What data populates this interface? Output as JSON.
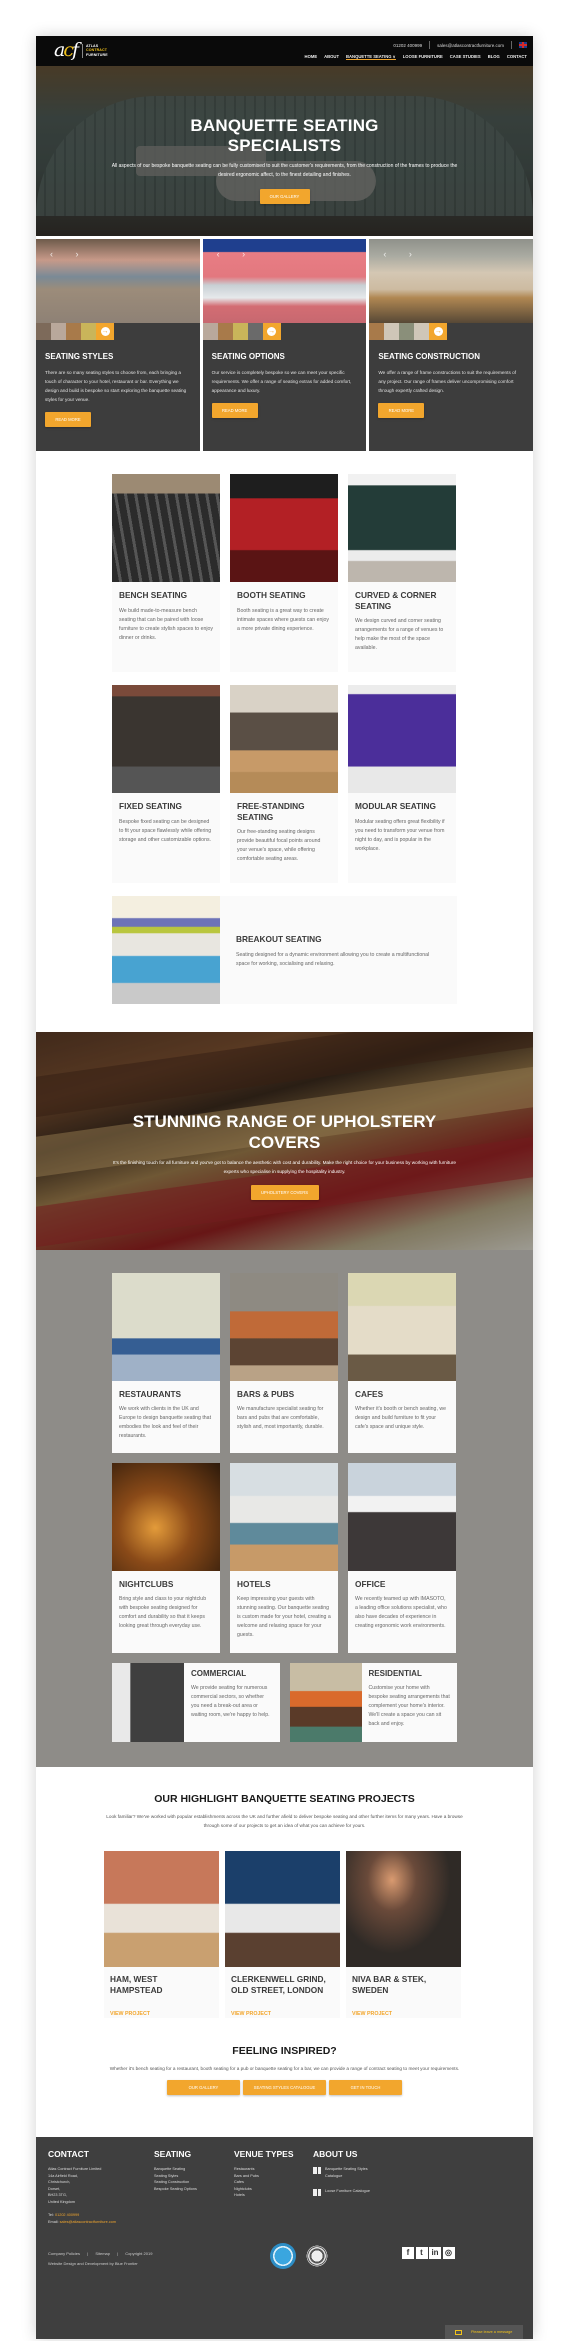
{
  "header": {
    "logo": {
      "mark_a": "a",
      "mark_c": "c",
      "mark_f": "f",
      "line1": "ATLAS",
      "line2": "CONTRACT",
      "line3": "FURNITURE"
    },
    "phone": "01202 400999",
    "email": "sales@atlascontractfurniture.com",
    "flag": "uk-flag-icon",
    "nav": [
      "HOME",
      "ABOUT",
      "BANQUETTE SEATING ∨",
      "LOOSE FURNITURE",
      "CASE STUDIES",
      "BLOG",
      "CONTACT"
    ],
    "active_nav": "BANQUETTE SEATING"
  },
  "hero": {
    "title_line1": "BANQUETTE SEATING",
    "title_line2": "SPECIALISTS",
    "description": "All aspects of our bespoke banquette seating can be fully customised to suit the customer's requirements, from the construction of the frames to produce the desired ergonomic affect, to the finest detailing and finishes.",
    "button": "OUR GALLERY"
  },
  "feature_cards": [
    {
      "title": "SEATING STYLES",
      "text": "There are so many seating styles to choose from, each bringing a touch of character to your hotel, restaurant or bar. Everything we design and build is bespoke so start exploring the banquette seating styles for your venue.",
      "button": "READ MORE"
    },
    {
      "title": "SEATING OPTIONS",
      "text": "Our service is completely bespoke so we can meet your specific requirements. We offer a range of seating extras for added comfort, appearance and luxury.",
      "button": "READ MORE"
    },
    {
      "title": "SEATING CONSTRUCTION",
      "text": "We offer a range of frame constructions to suit the requirements of any project. Our range of frames deliver uncompromising comfort through expertly crafted design.",
      "button": "READ MORE"
    }
  ],
  "slider_arrows": "‹ ›",
  "next_arrow": "→",
  "seating_types": [
    {
      "title": "BENCH SEATING",
      "text": "We build made-to-measure bench seating that can be paired with loose furniture to create stylish spaces to enjoy dinner or drinks."
    },
    {
      "title": "BOOTH SEATING",
      "text": "Booth seating is a great way to create intimate spaces where guests can enjoy a more private dining experience."
    },
    {
      "title": "CURVED & CORNER SEATING",
      "text": "We design curved and corner seating arrangements for a range of venues to help make the most of the space available."
    },
    {
      "title": "FIXED SEATING",
      "text": "Bespoke fixed seating can be designed to fit your space flawlessly while offering storage and other customizable options."
    },
    {
      "title": "FREE-STANDING SEATING",
      "text": "Our free-standing seating designs provide beautiful focal points around your venue's space, while offering comfortable seating areas."
    },
    {
      "title": "MODULAR SEATING",
      "text": "Modular seating offers great flexibility if you need to transform your venue from night to day, and is popular in the workplace."
    }
  ],
  "breakout": {
    "title": "BREAKOUT SEATING",
    "text": "Seating designed for a dynamic environment allowing you to create a multifunctional space for working, socialising and relaxing."
  },
  "upholstery": {
    "title_line1": "STUNNING RANGE OF UPHOLSTERY",
    "title_line2": "COVERS",
    "description": "It's the finishing touch for all furniture and you've got to balance the aesthetic with cost and durability. Make the right choice for your business by working with furniture experts who specialise in supplying the hospitality industry.",
    "button": "UPHOLSTERY COVERS"
  },
  "venues": [
    {
      "title": "RESTAURANTS",
      "text": "We work with clients in the UK and Europe to design banquette seating that embodies the look and feel of their restaurants."
    },
    {
      "title": "BARS & PUBS",
      "text": "We manufacture specialist seating for bars and pubs that are comfortable, stylish and, most importantly, durable."
    },
    {
      "title": "CAFES",
      "text": "Whether it's booth or bench seating, we design and build furniture to fit your cafe's space and unique style."
    },
    {
      "title": "NIGHTCLUBS",
      "text": "Bring style and class to your nightclub with bespoke seating designed for comfort and durability so that it keeps looking great through everyday use."
    },
    {
      "title": "HOTELS",
      "text": "Keep impressing your guests with stunning seating. Our banquette seating is custom made for your hotel, creating a welcome and relaxing space for your guests."
    },
    {
      "title": "OFFICE",
      "text": "We recently teamed up with IMASOTO, a leading office solutions specialist, who also have decades of experience in creating ergonomic work environments."
    },
    {
      "title": "COMMERCIAL",
      "text": "We provide seating for numerous commercial sectors, so whether you need a break-out area or waiting room, we're happy to help."
    },
    {
      "title": "RESIDENTIAL",
      "text": "Customise your home with bespoke seating arrangements that complement your home's interior. We'll create a space you can sit back and enjoy."
    }
  ],
  "projects": {
    "title": "OUR HIGHLIGHT BANQUETTE SEATING PROJECTS",
    "intro": "Look familiar? We've worked with popular establishments across the UK and further afield to deliver bespoke seating and other further items for many years. Have a browse through some of our projects to get an idea of what you can achieve for yours.",
    "items": [
      {
        "title_line1": "HAM, WEST",
        "title_line2": "HAMPSTEAD",
        "link": "VIEW PROJECT"
      },
      {
        "title_line1": "CLERKENWELL GRIND,",
        "title_line2": "OLD STREET, LONDON",
        "link": "VIEW PROJECT"
      },
      {
        "title_line1": "NIVA BAR & STEK,",
        "title_line2": "SWEDEN",
        "link": "VIEW PROJECT"
      }
    ]
  },
  "inspired": {
    "title": "FEELING INSPIRED?",
    "text": "Whether it's bench seating for a restaurant, booth seating for a pub or banquette seating for a bar, we can provide a range of contract seating to meet your requirements.",
    "buttons": [
      "OUR GALLERY",
      "SEATING STYLES CATALOGUE",
      "GET IN TOUCH"
    ]
  },
  "footer": {
    "contact": {
      "title": "CONTACT",
      "address": [
        "Atlas Contract Furniture Limited",
        "14a Airfield Road,",
        "Christchurch,",
        "Dorset,",
        "BH23 3TG,",
        "United Kingdom"
      ],
      "tel_label": "Tel:",
      "tel": "01202 400999",
      "email_label": "Email:",
      "email": "sales@atlascontractfurniture.com"
    },
    "seating": {
      "title": "SEATING",
      "links": [
        "Banquette Seating",
        "Seating Styles",
        "Seating Construction",
        "Bespoke Seating Options"
      ]
    },
    "venue_types": {
      "title": "VENUE TYPES",
      "links": [
        "Restaurants",
        "Bars and Pubs",
        "Cafes",
        "Nightclubs",
        "Hotels"
      ]
    },
    "about": {
      "title": "ABOUT US",
      "catalogues": [
        "Banquette Seating Styles Catalogue",
        "Loose Furniture Catalogue"
      ]
    },
    "bottom_links": [
      "Company Policies",
      "Sitemap",
      "Copyright 2019"
    ],
    "separator": "|",
    "credit": "Website Design and Development by Blue Frontier",
    "socials": [
      "f",
      "t",
      "in",
      "◎"
    ],
    "message": "Please leave a message"
  }
}
